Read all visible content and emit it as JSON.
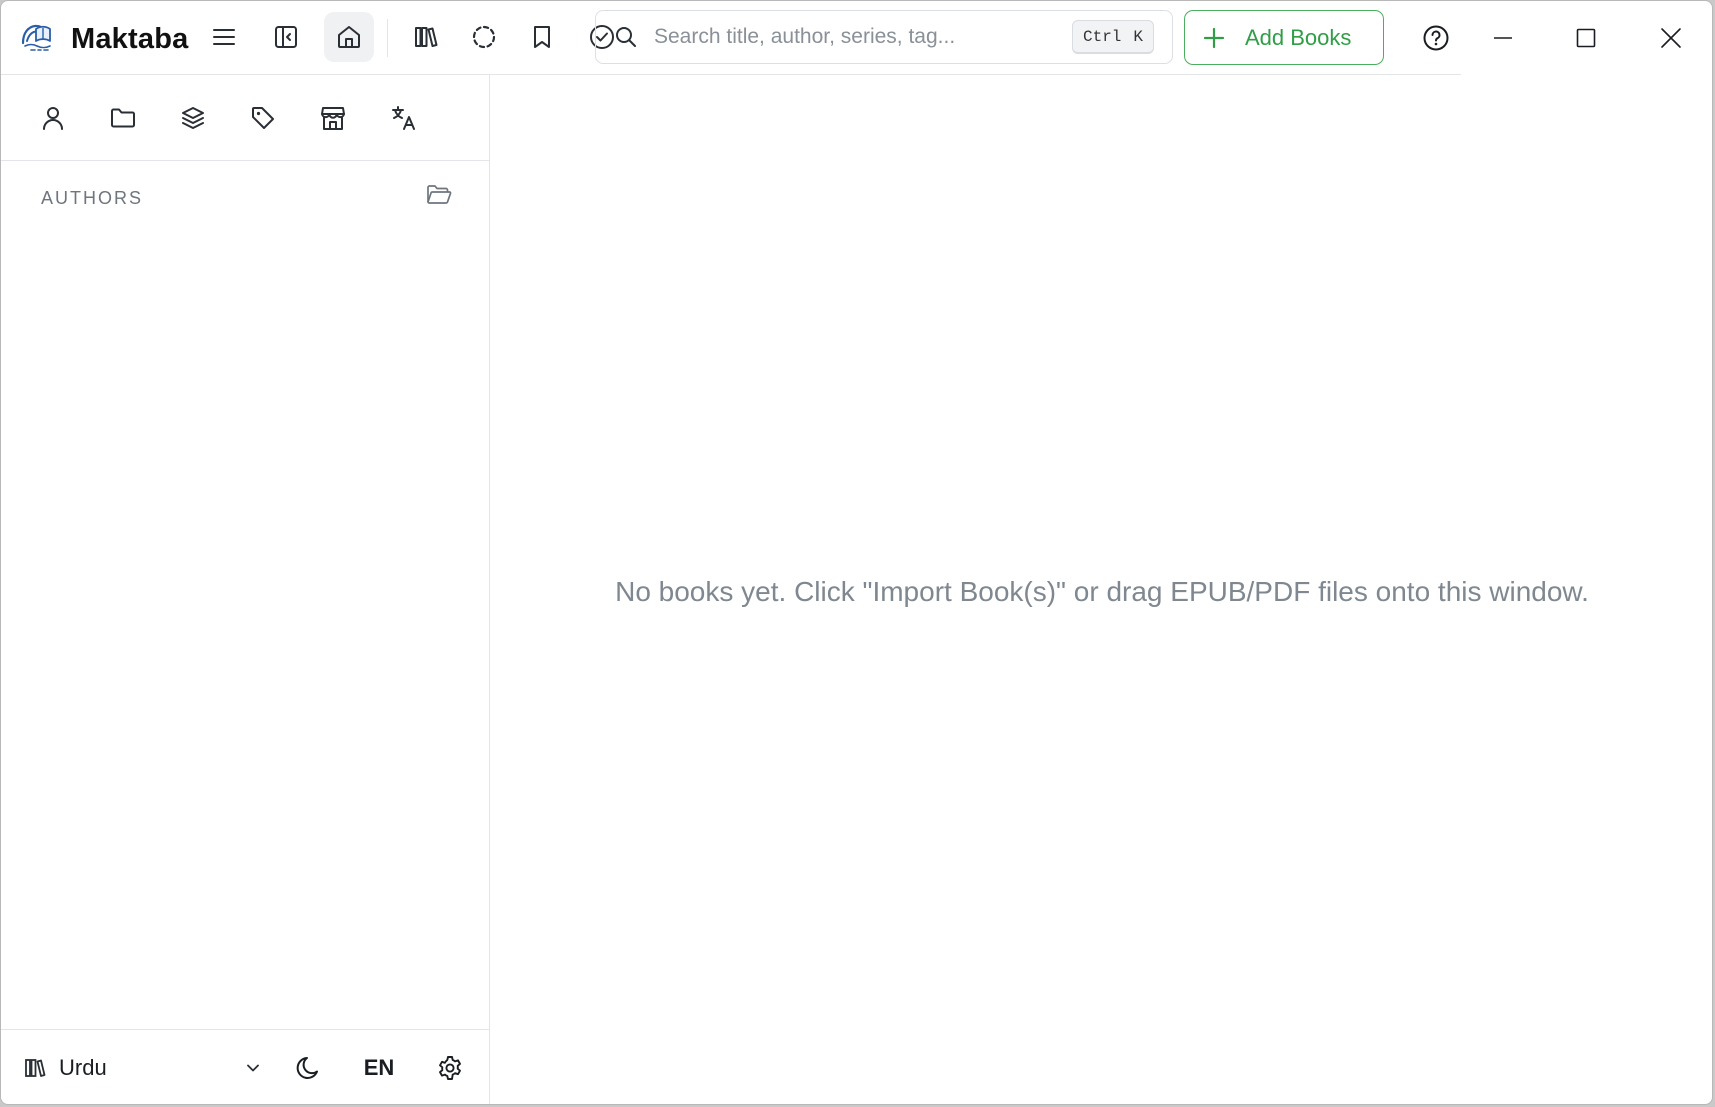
{
  "app": {
    "title": "Maktaba",
    "logo_icon": "maktaba-logo"
  },
  "toolbar": {
    "buttons": [
      {
        "name": "menu-icon",
        "label": "Menu"
      },
      {
        "name": "collapse-sidebar-icon",
        "label": "Toggle sidebar"
      },
      {
        "name": "home-icon",
        "label": "Home",
        "active": true
      },
      {
        "name": "library-icon",
        "label": "Library"
      },
      {
        "name": "in-progress-icon",
        "label": "Reading"
      },
      {
        "name": "bookmark-icon",
        "label": "Bookmarks"
      },
      {
        "name": "check-circle-icon",
        "label": "Finished"
      }
    ],
    "search": {
      "placeholder": "Search title, author, series, tag...",
      "value": "",
      "shortcut_mod": "Ctrl",
      "shortcut_key": "K"
    },
    "add_books_label": "Add Books",
    "accent_color": "#2f9e46"
  },
  "window_controls": [
    "help-icon",
    "minimize-icon",
    "maximize-icon",
    "close-icon"
  ],
  "sidebar": {
    "filter_tabs": [
      {
        "name": "authors-tab-icon",
        "label": "Authors",
        "active": true
      },
      {
        "name": "folders-tab-icon",
        "label": "Folders"
      },
      {
        "name": "series-tab-icon",
        "label": "Series"
      },
      {
        "name": "tags-tab-icon",
        "label": "Tags"
      },
      {
        "name": "publishers-tab-icon",
        "label": "Publishers"
      },
      {
        "name": "languages-tab-icon",
        "label": "Languages"
      }
    ],
    "section_title": "AUTHORS",
    "authors": [],
    "footer": {
      "library_name": "Urdu",
      "language_code": "EN",
      "theme_icon": "moon-icon",
      "settings_icon": "gear-icon"
    }
  },
  "main": {
    "empty_message": "No books yet. Click \"Import Book(s)\" or drag EPUB/PDF files onto this window."
  }
}
